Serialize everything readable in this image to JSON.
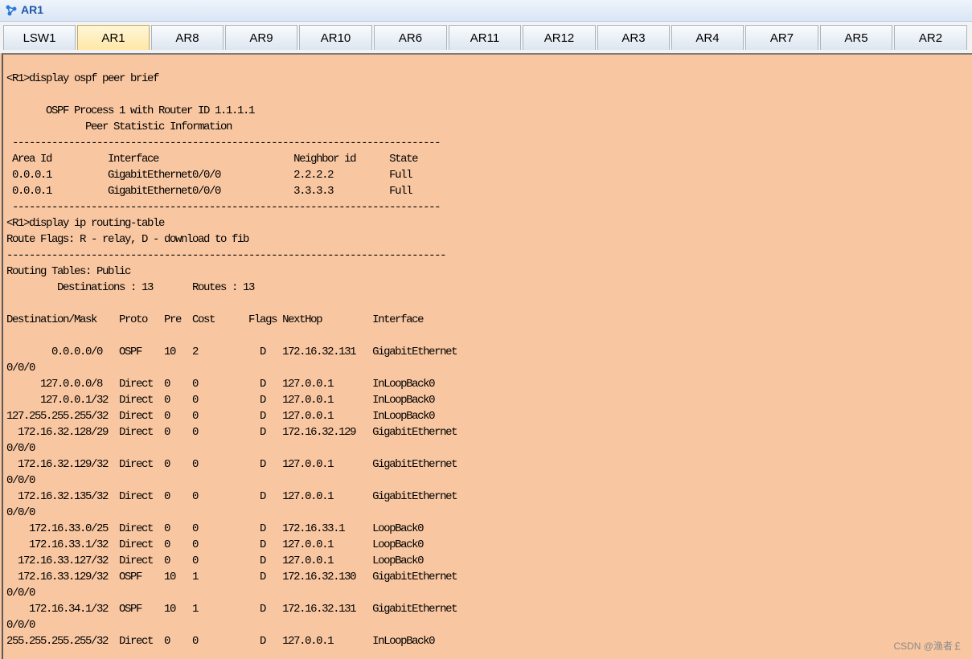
{
  "window": {
    "title": "AR1"
  },
  "tabs": [
    {
      "label": "LSW1",
      "active": false
    },
    {
      "label": "AR1",
      "active": true
    },
    {
      "label": "AR8",
      "active": false
    },
    {
      "label": "AR9",
      "active": false
    },
    {
      "label": "AR10",
      "active": false
    },
    {
      "label": "AR6",
      "active": false
    },
    {
      "label": "AR11",
      "active": false
    },
    {
      "label": "AR12",
      "active": false
    },
    {
      "label": "AR3",
      "active": false
    },
    {
      "label": "AR4",
      "active": false
    },
    {
      "label": "AR7",
      "active": false
    },
    {
      "label": "AR5",
      "active": false
    },
    {
      "label": "AR2",
      "active": false
    }
  ],
  "terminal": {
    "lines": [
      "<R1>display ospf peer brief",
      "",
      "       OSPF Process 1 with Router ID 1.1.1.1",
      "              Peer Statistic Information",
      " ----------------------------------------------------------------------------",
      " Area Id          Interface                        Neighbor id      State",
      " 0.0.0.1          GigabitEthernet0/0/0             2.2.2.2          Full",
      " 0.0.0.1          GigabitEthernet0/0/0             3.3.3.3          Full",
      " ----------------------------------------------------------------------------",
      "<R1>display ip routing-table",
      "Route Flags: R - relay, D - download to fib",
      "------------------------------------------------------------------------------",
      "Routing Tables: Public",
      "         Destinations : 13       Routes : 13",
      "",
      "Destination/Mask    Proto   Pre  Cost      Flags NextHop         Interface",
      "",
      "        0.0.0.0/0   OSPF    10   2           D   172.16.32.131   GigabitEthernet",
      "0/0/0",
      "      127.0.0.0/8   Direct  0    0           D   127.0.0.1       InLoopBack0",
      "      127.0.0.1/32  Direct  0    0           D   127.0.0.1       InLoopBack0",
      "127.255.255.255/32  Direct  0    0           D   127.0.0.1       InLoopBack0",
      "  172.16.32.128/29  Direct  0    0           D   172.16.32.129   GigabitEthernet",
      "0/0/0",
      "  172.16.32.129/32  Direct  0    0           D   127.0.0.1       GigabitEthernet",
      "0/0/0",
      "  172.16.32.135/32  Direct  0    0           D   127.0.0.1       GigabitEthernet",
      "0/0/0",
      "    172.16.33.0/25  Direct  0    0           D   172.16.33.1     LoopBack0",
      "    172.16.33.1/32  Direct  0    0           D   127.0.0.1       LoopBack0",
      "  172.16.33.127/32  Direct  0    0           D   127.0.0.1       LoopBack0",
      "  172.16.33.129/32  OSPF    10   1           D   172.16.32.130   GigabitEthernet",
      "0/0/0",
      "    172.16.34.1/32  OSPF    10   1           D   172.16.32.131   GigabitEthernet",
      "0/0/0",
      "255.255.255.255/32  Direct  0    0           D   127.0.0.1       InLoopBack0"
    ]
  },
  "watermark": "CSDN @渔者￡",
  "colors": {
    "terminal_bg": "#f8c6a0",
    "title_text": "#1e55a8",
    "active_tab": "#ffe7a6"
  },
  "icons": {
    "app": "router-network-icon"
  }
}
